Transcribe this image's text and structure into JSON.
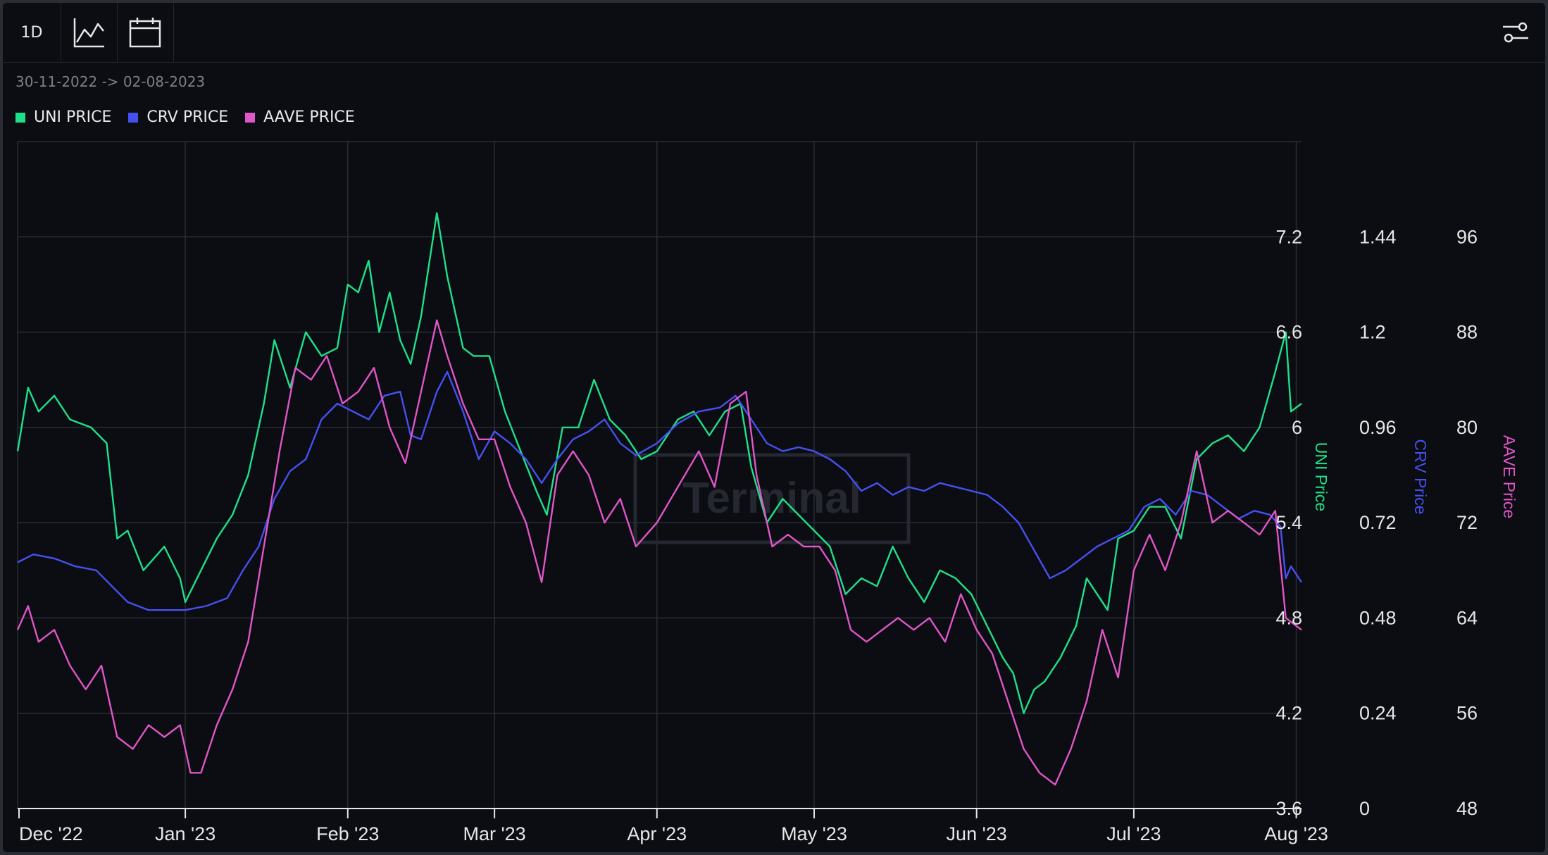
{
  "toolbar": {
    "interval_label": "1D",
    "chart_type_icon": "line-chart-icon",
    "date_icon": "calendar-icon",
    "settings_icon": "sliders-icon"
  },
  "date_range": "30-11-2022 -> 02-08-2023",
  "legend": [
    {
      "label": "UNI PRICE",
      "color": "#1fe08a"
    },
    {
      "label": "CRV PRICE",
      "color": "#4650f0"
    },
    {
      "label": "AAVE PRICE",
      "color": "#e055c8"
    }
  ],
  "watermark": "Terminal",
  "chart_data": {
    "type": "line",
    "x_ticks": [
      "Dec '22",
      "Jan '23",
      "Feb '23",
      "Mar '23",
      "Apr '23",
      "May '23",
      "Jun '23",
      "Jul '23",
      "Aug '23"
    ],
    "axes": [
      {
        "label": "UNI Price",
        "ticks": [
          "3.6",
          "4.2",
          "4.8",
          "5.4",
          "6",
          "6.6",
          "7.2"
        ],
        "range": [
          3.6,
          7.8
        ],
        "color": "#1fe08a"
      },
      {
        "label": "CRV Price",
        "ticks": [
          "0",
          "0.24",
          "0.48",
          "0.72",
          "0.96",
          "1.2",
          "1.44"
        ],
        "range": [
          0,
          1.68
        ],
        "color": "#4650f0"
      },
      {
        "label": "AAVE Price",
        "ticks": [
          "48",
          "56",
          "64",
          "72",
          "80",
          "88",
          "96"
        ],
        "range": [
          48,
          104
        ],
        "color": "#e055c8"
      }
    ],
    "grid": true,
    "legend_position": "top-left",
    "series": [
      {
        "name": "UNI PRICE",
        "color": "#1fe08a",
        "axis": 0,
        "points": [
          [
            "2022-11-30",
            5.85
          ],
          [
            "2022-12-02",
            6.25
          ],
          [
            "2022-12-04",
            6.1
          ],
          [
            "2022-12-07",
            6.2
          ],
          [
            "2022-12-10",
            6.05
          ],
          [
            "2022-12-14",
            6.0
          ],
          [
            "2022-12-17",
            5.9
          ],
          [
            "2022-12-19",
            5.3
          ],
          [
            "2022-12-21",
            5.35
          ],
          [
            "2022-12-24",
            5.1
          ],
          [
            "2022-12-28",
            5.25
          ],
          [
            "2022-12-31",
            5.05
          ],
          [
            "2023-01-01",
            4.9
          ],
          [
            "2023-01-04",
            5.1
          ],
          [
            "2023-01-07",
            5.3
          ],
          [
            "2023-01-10",
            5.45
          ],
          [
            "2023-01-13",
            5.7
          ],
          [
            "2023-01-16",
            6.15
          ],
          [
            "2023-01-18",
            6.55
          ],
          [
            "2023-01-21",
            6.25
          ],
          [
            "2023-01-24",
            6.6
          ],
          [
            "2023-01-27",
            6.45
          ],
          [
            "2023-01-30",
            6.5
          ],
          [
            "2023-02-01",
            6.9
          ],
          [
            "2023-02-03",
            6.85
          ],
          [
            "2023-02-05",
            7.05
          ],
          [
            "2023-02-07",
            6.6
          ],
          [
            "2023-02-09",
            6.85
          ],
          [
            "2023-02-11",
            6.55
          ],
          [
            "2023-02-13",
            6.4
          ],
          [
            "2023-02-15",
            6.7
          ],
          [
            "2023-02-18",
            7.35
          ],
          [
            "2023-02-20",
            6.95
          ],
          [
            "2023-02-23",
            6.5
          ],
          [
            "2023-02-25",
            6.45
          ],
          [
            "2023-02-28",
            6.45
          ],
          [
            "2023-03-03",
            6.1
          ],
          [
            "2023-03-06",
            5.85
          ],
          [
            "2023-03-09",
            5.6
          ],
          [
            "2023-03-11",
            5.45
          ],
          [
            "2023-03-14",
            6.0
          ],
          [
            "2023-03-17",
            6.0
          ],
          [
            "2023-03-20",
            6.3
          ],
          [
            "2023-03-23",
            6.05
          ],
          [
            "2023-03-26",
            5.95
          ],
          [
            "2023-03-29",
            5.8
          ],
          [
            "2023-04-01",
            5.85
          ],
          [
            "2023-04-05",
            6.05
          ],
          [
            "2023-04-08",
            6.1
          ],
          [
            "2023-04-11",
            5.95
          ],
          [
            "2023-04-14",
            6.1
          ],
          [
            "2023-04-17",
            6.15
          ],
          [
            "2023-04-19",
            5.75
          ],
          [
            "2023-04-22",
            5.4
          ],
          [
            "2023-04-25",
            5.55
          ],
          [
            "2023-04-28",
            5.45
          ],
          [
            "2023-05-01",
            5.35
          ],
          [
            "2023-05-04",
            5.25
          ],
          [
            "2023-05-07",
            4.95
          ],
          [
            "2023-05-10",
            5.05
          ],
          [
            "2023-05-13",
            5.0
          ],
          [
            "2023-05-16",
            5.25
          ],
          [
            "2023-05-19",
            5.05
          ],
          [
            "2023-05-22",
            4.9
          ],
          [
            "2023-05-25",
            5.1
          ],
          [
            "2023-05-28",
            5.05
          ],
          [
            "2023-05-31",
            4.95
          ],
          [
            "2023-06-03",
            4.75
          ],
          [
            "2023-06-06",
            4.55
          ],
          [
            "2023-06-08",
            4.45
          ],
          [
            "2023-06-10",
            4.2
          ],
          [
            "2023-06-12",
            4.35
          ],
          [
            "2023-06-14",
            4.4
          ],
          [
            "2023-06-17",
            4.55
          ],
          [
            "2023-06-20",
            4.75
          ],
          [
            "2023-06-22",
            5.05
          ],
          [
            "2023-06-24",
            4.95
          ],
          [
            "2023-06-26",
            4.85
          ],
          [
            "2023-06-28",
            5.3
          ],
          [
            "2023-07-01",
            5.35
          ],
          [
            "2023-07-04",
            5.5
          ],
          [
            "2023-07-07",
            5.5
          ],
          [
            "2023-07-10",
            5.3
          ],
          [
            "2023-07-13",
            5.8
          ],
          [
            "2023-07-16",
            5.9
          ],
          [
            "2023-07-19",
            5.95
          ],
          [
            "2023-07-22",
            5.85
          ],
          [
            "2023-07-25",
            6.0
          ],
          [
            "2023-07-28",
            6.35
          ],
          [
            "2023-07-30",
            6.6
          ],
          [
            "2023-07-31",
            6.1
          ],
          [
            "2023-08-02",
            6.15
          ]
        ]
      },
      {
        "name": "CRV PRICE",
        "color": "#4650f0",
        "axis": 1,
        "points": [
          [
            "2022-11-30",
            0.62
          ],
          [
            "2022-12-03",
            0.64
          ],
          [
            "2022-12-07",
            0.63
          ],
          [
            "2022-12-11",
            0.61
          ],
          [
            "2022-12-15",
            0.6
          ],
          [
            "2022-12-18",
            0.56
          ],
          [
            "2022-12-21",
            0.52
          ],
          [
            "2022-12-25",
            0.5
          ],
          [
            "2022-12-29",
            0.5
          ],
          [
            "2023-01-01",
            0.5
          ],
          [
            "2023-01-05",
            0.51
          ],
          [
            "2023-01-09",
            0.53
          ],
          [
            "2023-01-12",
            0.6
          ],
          [
            "2023-01-15",
            0.66
          ],
          [
            "2023-01-18",
            0.78
          ],
          [
            "2023-01-21",
            0.85
          ],
          [
            "2023-01-24",
            0.88
          ],
          [
            "2023-01-27",
            0.98
          ],
          [
            "2023-01-30",
            1.02
          ],
          [
            "2023-02-02",
            1.0
          ],
          [
            "2023-02-05",
            0.98
          ],
          [
            "2023-02-08",
            1.04
          ],
          [
            "2023-02-11",
            1.05
          ],
          [
            "2023-02-13",
            0.94
          ],
          [
            "2023-02-15",
            0.93
          ],
          [
            "2023-02-18",
            1.05
          ],
          [
            "2023-02-20",
            1.1
          ],
          [
            "2023-02-23",
            1.0
          ],
          [
            "2023-02-26",
            0.88
          ],
          [
            "2023-03-01",
            0.95
          ],
          [
            "2023-03-04",
            0.92
          ],
          [
            "2023-03-07",
            0.88
          ],
          [
            "2023-03-10",
            0.82
          ],
          [
            "2023-03-13",
            0.88
          ],
          [
            "2023-03-16",
            0.93
          ],
          [
            "2023-03-19",
            0.95
          ],
          [
            "2023-03-22",
            0.98
          ],
          [
            "2023-03-25",
            0.92
          ],
          [
            "2023-03-28",
            0.89
          ],
          [
            "2023-04-01",
            0.92
          ],
          [
            "2023-04-05",
            0.97
          ],
          [
            "2023-04-09",
            1.0
          ],
          [
            "2023-04-13",
            1.01
          ],
          [
            "2023-04-16",
            1.04
          ],
          [
            "2023-04-19",
            0.98
          ],
          [
            "2023-04-22",
            0.92
          ],
          [
            "2023-04-25",
            0.9
          ],
          [
            "2023-04-28",
            0.91
          ],
          [
            "2023-05-01",
            0.9
          ],
          [
            "2023-05-04",
            0.88
          ],
          [
            "2023-05-07",
            0.85
          ],
          [
            "2023-05-10",
            0.8
          ],
          [
            "2023-05-13",
            0.82
          ],
          [
            "2023-05-16",
            0.79
          ],
          [
            "2023-05-19",
            0.81
          ],
          [
            "2023-05-22",
            0.8
          ],
          [
            "2023-05-25",
            0.82
          ],
          [
            "2023-05-28",
            0.81
          ],
          [
            "2023-05-31",
            0.8
          ],
          [
            "2023-06-03",
            0.79
          ],
          [
            "2023-06-06",
            0.76
          ],
          [
            "2023-06-09",
            0.72
          ],
          [
            "2023-06-12",
            0.65
          ],
          [
            "2023-06-15",
            0.58
          ],
          [
            "2023-06-18",
            0.6
          ],
          [
            "2023-06-21",
            0.63
          ],
          [
            "2023-06-24",
            0.66
          ],
          [
            "2023-06-27",
            0.68
          ],
          [
            "2023-06-30",
            0.7
          ],
          [
            "2023-07-03",
            0.76
          ],
          [
            "2023-07-06",
            0.78
          ],
          [
            "2023-07-09",
            0.74
          ],
          [
            "2023-07-12",
            0.8
          ],
          [
            "2023-07-15",
            0.79
          ],
          [
            "2023-07-18",
            0.76
          ],
          [
            "2023-07-21",
            0.73
          ],
          [
            "2023-07-24",
            0.75
          ],
          [
            "2023-07-27",
            0.74
          ],
          [
            "2023-07-29",
            0.71
          ],
          [
            "2023-07-30",
            0.58
          ],
          [
            "2023-07-31",
            0.61
          ],
          [
            "2023-08-02",
            0.57
          ]
        ]
      },
      {
        "name": "AAVE PRICE",
        "color": "#e055c8",
        "axis": 2,
        "points": [
          [
            "2022-11-30",
            63
          ],
          [
            "2022-12-02",
            65
          ],
          [
            "2022-12-04",
            62
          ],
          [
            "2022-12-07",
            63
          ],
          [
            "2022-12-10",
            60
          ],
          [
            "2022-12-13",
            58
          ],
          [
            "2022-12-16",
            60
          ],
          [
            "2022-12-19",
            54
          ],
          [
            "2022-12-22",
            53
          ],
          [
            "2022-12-25",
            55
          ],
          [
            "2022-12-28",
            54
          ],
          [
            "2022-12-31",
            55
          ],
          [
            "2023-01-02",
            51
          ],
          [
            "2023-01-04",
            51
          ],
          [
            "2023-01-07",
            55
          ],
          [
            "2023-01-10",
            58
          ],
          [
            "2023-01-13",
            62
          ],
          [
            "2023-01-16",
            70
          ],
          [
            "2023-01-19",
            78
          ],
          [
            "2023-01-22",
            85
          ],
          [
            "2023-01-25",
            84
          ],
          [
            "2023-01-28",
            86
          ],
          [
            "2023-01-31",
            82
          ],
          [
            "2023-02-03",
            83
          ],
          [
            "2023-02-06",
            85
          ],
          [
            "2023-02-09",
            80
          ],
          [
            "2023-02-12",
            77
          ],
          [
            "2023-02-15",
            83
          ],
          [
            "2023-02-18",
            89
          ],
          [
            "2023-02-20",
            86
          ],
          [
            "2023-02-23",
            82
          ],
          [
            "2023-02-26",
            79
          ],
          [
            "2023-03-01",
            79
          ],
          [
            "2023-03-04",
            75
          ],
          [
            "2023-03-07",
            72
          ],
          [
            "2023-03-10",
            67
          ],
          [
            "2023-03-13",
            76
          ],
          [
            "2023-03-16",
            78
          ],
          [
            "2023-03-19",
            76
          ],
          [
            "2023-03-22",
            72
          ],
          [
            "2023-03-25",
            74
          ],
          [
            "2023-03-28",
            70
          ],
          [
            "2023-04-01",
            72
          ],
          [
            "2023-04-05",
            75
          ],
          [
            "2023-04-09",
            78
          ],
          [
            "2023-04-12",
            75
          ],
          [
            "2023-04-15",
            82
          ],
          [
            "2023-04-18",
            83
          ],
          [
            "2023-04-20",
            76
          ],
          [
            "2023-04-23",
            70
          ],
          [
            "2023-04-26",
            71
          ],
          [
            "2023-04-29",
            70
          ],
          [
            "2023-05-02",
            70
          ],
          [
            "2023-05-05",
            68
          ],
          [
            "2023-05-08",
            63
          ],
          [
            "2023-05-11",
            62
          ],
          [
            "2023-05-14",
            63
          ],
          [
            "2023-05-17",
            64
          ],
          [
            "2023-05-20",
            63
          ],
          [
            "2023-05-23",
            64
          ],
          [
            "2023-05-26",
            62
          ],
          [
            "2023-05-29",
            66
          ],
          [
            "2023-06-01",
            63
          ],
          [
            "2023-06-04",
            61
          ],
          [
            "2023-06-07",
            57
          ],
          [
            "2023-06-10",
            53
          ],
          [
            "2023-06-13",
            51
          ],
          [
            "2023-06-16",
            50
          ],
          [
            "2023-06-19",
            53
          ],
          [
            "2023-06-22",
            57
          ],
          [
            "2023-06-25",
            63
          ],
          [
            "2023-06-28",
            59
          ],
          [
            "2023-07-01",
            68
          ],
          [
            "2023-07-04",
            71
          ],
          [
            "2023-07-07",
            68
          ],
          [
            "2023-07-10",
            72
          ],
          [
            "2023-07-13",
            78
          ],
          [
            "2023-07-16",
            72
          ],
          [
            "2023-07-19",
            73
          ],
          [
            "2023-07-22",
            72
          ],
          [
            "2023-07-25",
            71
          ],
          [
            "2023-07-28",
            73
          ],
          [
            "2023-07-30",
            64
          ],
          [
            "2023-08-02",
            63
          ]
        ]
      }
    ]
  }
}
